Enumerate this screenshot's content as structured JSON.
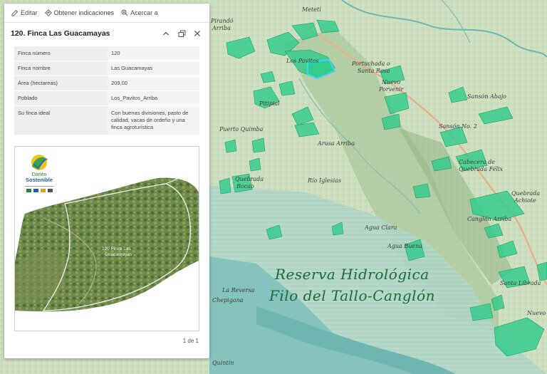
{
  "toolbar": {
    "edit": "Editar",
    "directions": "Obtener indicaciones",
    "zoom_to": "Acercar a"
  },
  "popup": {
    "title": "120. Finca Las Guacamayas",
    "attributes": [
      {
        "key": "Finca número",
        "value": "120"
      },
      {
        "key": "Finca nombre",
        "value": "Las Guacamayas"
      },
      {
        "key": "Área (hectareas)",
        "value": "209,00"
      },
      {
        "key": "Poblado",
        "value": "Los_Pavitos_Arriba"
      },
      {
        "key": "Su finca ideal",
        "value": "Con buenas divisiones, pasto de calidad, vacas de ordeño y una finca agroturística"
      }
    ],
    "image": {
      "logo_line1": "Darién",
      "logo_line2": "Sostenible",
      "parcel_label_line1": "120 Finca Las",
      "parcel_label_line2": "Guacamayas"
    },
    "pager": "1 de 1"
  },
  "map": {
    "reserve_title_line1": "Reserva Hidrológica",
    "reserve_title_line2": "Filo del Tallo-Canglón",
    "place_labels": [
      "Metetí",
      "Pirandó Arriba",
      "Portuchada o Santa Rosa",
      "Nuevo Porvenir",
      "Sansón Abajo",
      "Sansón No. 2",
      "Cabecera de Quebrada Félix",
      "Quebrada Achiote",
      "Canglón Arriba",
      "Santa Librada",
      "Nuevo",
      "Puerto Quimba",
      "Quebrada Bocao",
      "Río Iglesias",
      "Arusa Arriba",
      "Agua Clara",
      "Agua Buena",
      "La Reversa",
      "Chepigana",
      "Quintín",
      "Los Pavitos Arriba",
      "Pitipial"
    ]
  },
  "colors": {
    "popup_bg": "#ffffff",
    "parcel_fill": "#2ecc8a",
    "highlight_outline": "#35d6ff",
    "reserve_text": "#1d6b3a",
    "water": "#8fc7c2"
  },
  "icons": [
    "edit-icon",
    "directions-icon",
    "zoom-icon",
    "collapse-icon",
    "dock-icon",
    "close-icon"
  ]
}
